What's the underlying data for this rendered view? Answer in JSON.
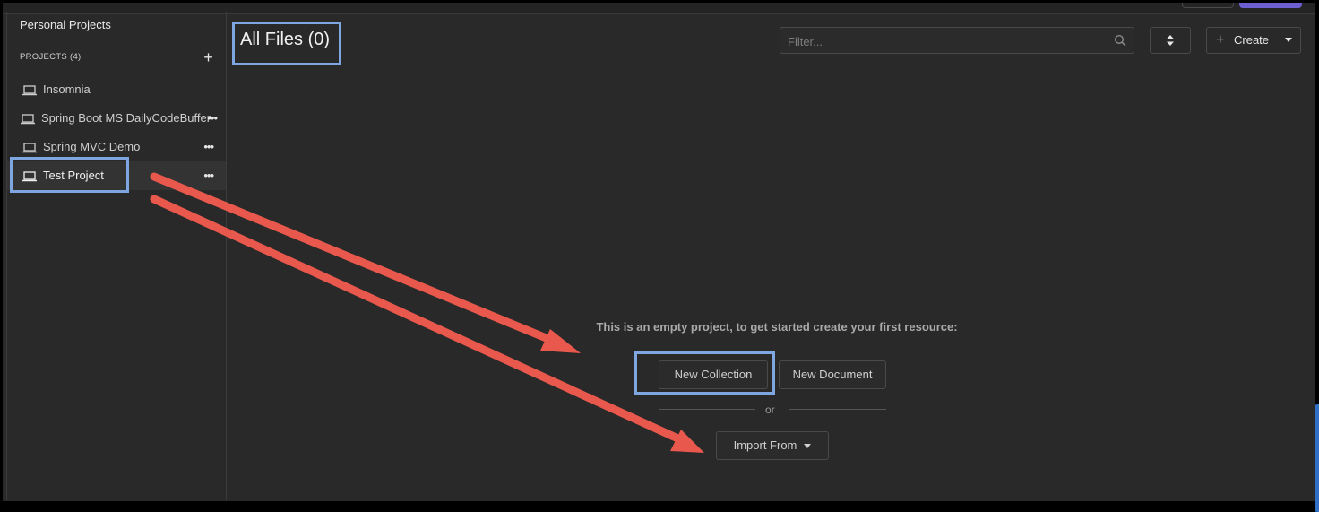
{
  "sidebar": {
    "title": "Personal Projects",
    "projects_header": "PROJECTS (4)",
    "add_icon": "+",
    "projects": [
      {
        "name": "Insomnia",
        "icon": "laptop-icon",
        "menu": "",
        "active": false
      },
      {
        "name": "Spring Boot MS DailyCodeBuffer",
        "icon": "laptop-icon",
        "menu": "•••",
        "active": false
      },
      {
        "name": "Spring MVC Demo",
        "icon": "laptop-icon",
        "menu": "•••",
        "active": false
      },
      {
        "name": "Test Project",
        "icon": "laptop-icon",
        "menu": "•••",
        "active": true
      }
    ]
  },
  "main": {
    "title": "All Files (0)",
    "filter_placeholder": "Filter...",
    "create_label": "Create",
    "create_plus": "+",
    "empty_message": "This is an empty project, to get started create your first resource:",
    "new_collection_label": "New Collection",
    "new_document_label": "New Document",
    "or_label": "or",
    "import_label": "Import From"
  },
  "colors": {
    "background": "#292929",
    "highlight_box": "#7ea6e0",
    "annotation_arrow": "#e8584d"
  }
}
